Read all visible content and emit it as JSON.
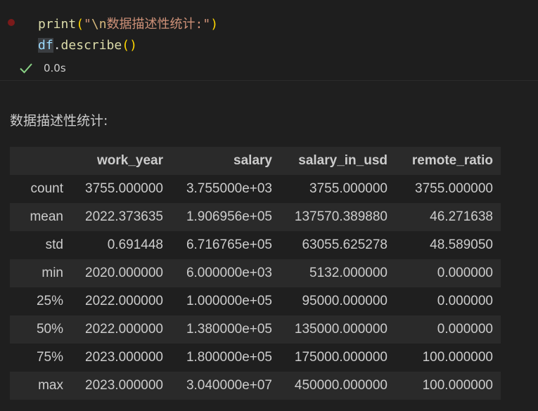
{
  "cell": {
    "code_line1": {
      "fn": "print",
      "open": "(",
      "str_q1": "\"",
      "escape": "\\n",
      "str_text": "数据描述性统计:",
      "str_q2": "\"",
      "close": ")"
    },
    "code_line2": {
      "ident": "df",
      "dot": ".",
      "method": "describe",
      "parens": "()"
    },
    "exec_time": "0.0s"
  },
  "output": {
    "print_text": "数据描述性统计:",
    "table": {
      "columns": [
        "",
        "work_year",
        "salary",
        "salary_in_usd",
        "remote_ratio"
      ],
      "rows": [
        [
          "count",
          "3755.000000",
          "3.755000e+03",
          "3755.000000",
          "3755.000000"
        ],
        [
          "mean",
          "2022.373635",
          "1.906956e+05",
          "137570.389880",
          "46.271638"
        ],
        [
          "std",
          "0.691448",
          "6.716765e+05",
          "63055.625278",
          "48.589050"
        ],
        [
          "min",
          "2020.000000",
          "6.000000e+03",
          "5132.000000",
          "0.000000"
        ],
        [
          "25%",
          "2022.000000",
          "1.000000e+05",
          "95000.000000",
          "0.000000"
        ],
        [
          "50%",
          "2022.000000",
          "1.380000e+05",
          "135000.000000",
          "0.000000"
        ],
        [
          "75%",
          "2023.000000",
          "1.800000e+05",
          "175000.000000",
          "100.000000"
        ],
        [
          "max",
          "2023.000000",
          "3.040000e+07",
          "450000.000000",
          "100.000000"
        ]
      ]
    }
  },
  "colors": {
    "check": "#89d185",
    "run_dot": "#7a1a1a"
  }
}
